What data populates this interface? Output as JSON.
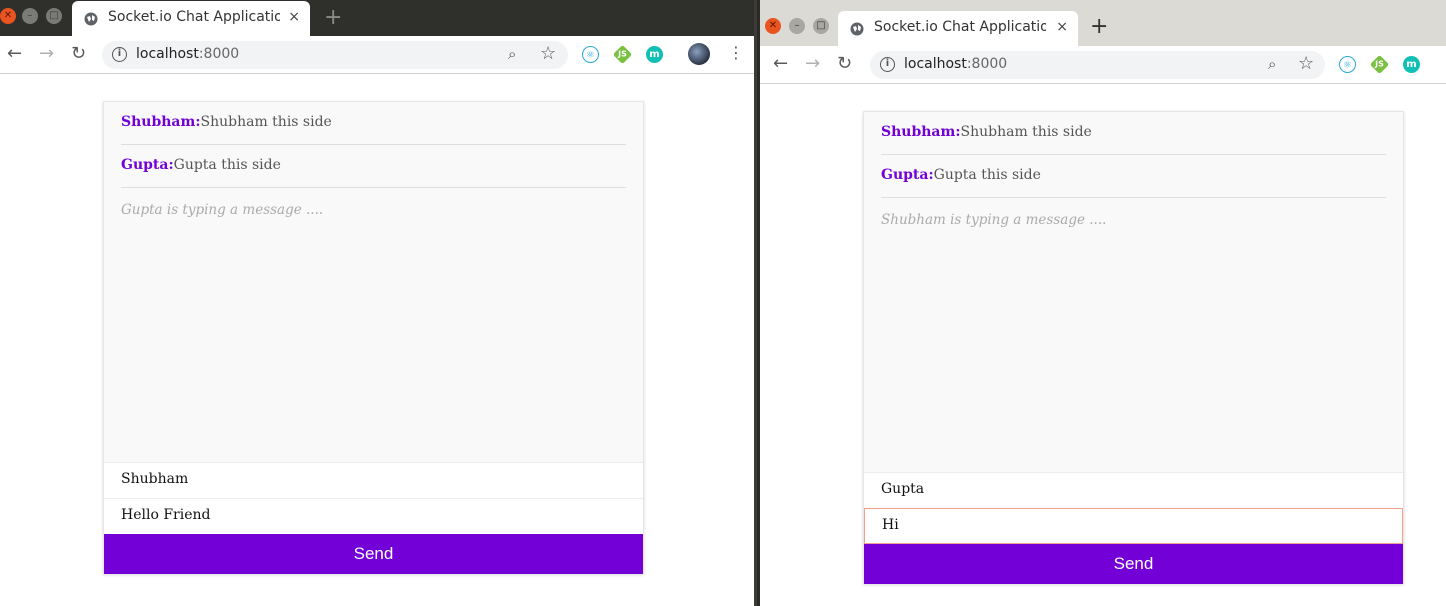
{
  "windows": [
    {
      "tab_title": "Socket.io Chat Application",
      "tab_close": "×",
      "new_tab": "+",
      "url_host": "localhost",
      "url_port": ":8000",
      "messages": [
        {
          "user": "Shubham:",
          "text": "Shubham this side"
        },
        {
          "user": "Gupta:",
          "text": "Gupta this side"
        }
      ],
      "typing_indicator": "Gupta is typing a message ....",
      "name_value": "Shubham",
      "message_value": "Hello Friend",
      "send_label": "Send"
    },
    {
      "tab_title": "Socket.io Chat Application",
      "tab_close": "×",
      "new_tab": "+",
      "url_host": "localhost",
      "url_port": ":8000",
      "messages": [
        {
          "user": "Shubham:",
          "text": "Shubham this side"
        },
        {
          "user": "Gupta:",
          "text": "Gupta this side"
        }
      ],
      "typing_indicator": "Shubham is typing a message ....",
      "name_value": "Gupta",
      "message_value": "Hi",
      "send_label": "Send"
    }
  ],
  "colors": {
    "accent": "#7300d6",
    "focus_border": "#f3a091",
    "window_close": "#e95420"
  },
  "icons": [
    "globe-icon",
    "back-icon",
    "forward-icon",
    "reload-icon",
    "info-icon",
    "zoom-icon",
    "star-icon",
    "react-extension-icon",
    "node-extension-icon",
    "m-extension-icon",
    "profile-avatar",
    "menu-icon"
  ]
}
